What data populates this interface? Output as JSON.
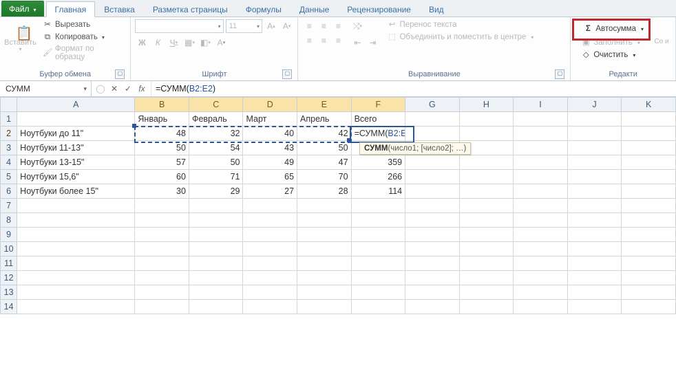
{
  "tabs": {
    "file": "Файл",
    "home": "Главная",
    "insert": "Вставка",
    "layout": "Разметка страницы",
    "formulas": "Формулы",
    "data": "Данные",
    "review": "Рецензирование",
    "view": "Вид"
  },
  "clipboard": {
    "paste": "Вставить",
    "cut": "Вырезать",
    "copy": "Копировать",
    "format_painter": "Формат по образцу",
    "title": "Буфер обмена"
  },
  "font": {
    "family_placeholder": "",
    "size_placeholder": "11",
    "grow": "A",
    "shrink": "A",
    "bold": "Ж",
    "italic": "К",
    "underline": "Ч",
    "title": "Шрифт"
  },
  "alignment": {
    "wrap": "Перенос текста",
    "merge": "Объединить и поместить в центре",
    "title": "Выравнивание"
  },
  "editing": {
    "autosum": "Автосумма",
    "fill": "Заполнить",
    "clear": "Очистить",
    "title": "Редакти",
    "sort_hint": "Со и"
  },
  "formula_bar": {
    "name": "СУММ",
    "fx": "fx",
    "formula_prefix": "=СУММ(",
    "formula_ref": "B2:E2",
    "formula_suffix": ")"
  },
  "columns": [
    "A",
    "B",
    "C",
    "D",
    "E",
    "F",
    "G",
    "H",
    "I",
    "J",
    "K"
  ],
  "row_numbers": [
    "1",
    "2",
    "3",
    "4",
    "5",
    "6",
    "7",
    "8",
    "9",
    "10",
    "11",
    "12",
    "13",
    "14"
  ],
  "headers": {
    "b": "Январь",
    "c": "Февраль",
    "d": "Март",
    "e": "Апрель",
    "f": "Всего"
  },
  "rows": [
    {
      "a": "Ноутбуки до 11\"",
      "b": "48",
      "c": "32",
      "d": "40",
      "e": "42",
      "f_formula_prefix": "=СУММ(",
      "f_ref": "B2:E2",
      "f_suffix": ")"
    },
    {
      "a": "Ноутбуки 11-13\"",
      "b": "50",
      "c": "54",
      "d": "43",
      "e": "50",
      "f": ""
    },
    {
      "a": "Ноутбуки 13-15\"",
      "b": "57",
      "c": "50",
      "d": "49",
      "e": "47",
      "f": "359"
    },
    {
      "a": "Ноутбуки 15,6\"",
      "b": "60",
      "c": "71",
      "d": "65",
      "e": "70",
      "f": "266"
    },
    {
      "a": "Ноутбуки более 15\"",
      "b": "30",
      "c": "29",
      "d": "27",
      "e": "28",
      "f": "114"
    }
  ],
  "tooltip": {
    "bold": "СУММ",
    "rest": "(число1; [число2]; …)"
  },
  "chart_data": {
    "type": "table",
    "categories": [
      "Январь",
      "Февраль",
      "Март",
      "Апрель"
    ],
    "series": [
      {
        "name": "Ноутбуки до 11\"",
        "values": [
          48,
          32,
          40,
          42
        ]
      },
      {
        "name": "Ноутбуки 11-13\"",
        "values": [
          50,
          54,
          43,
          50
        ]
      },
      {
        "name": "Ноутбуки 13-15\"",
        "values": [
          57,
          50,
          49,
          47
        ]
      },
      {
        "name": "Ноутбуки 15,6\"",
        "values": [
          60,
          71,
          65,
          70
        ]
      },
      {
        "name": "Ноутбуки более 15\"",
        "values": [
          30,
          29,
          27,
          28
        ]
      }
    ],
    "totals_column": "Всего",
    "totals": [
      null,
      null,
      359,
      266,
      114
    ],
    "active_formula": "=СУММ(B2:E2)"
  }
}
